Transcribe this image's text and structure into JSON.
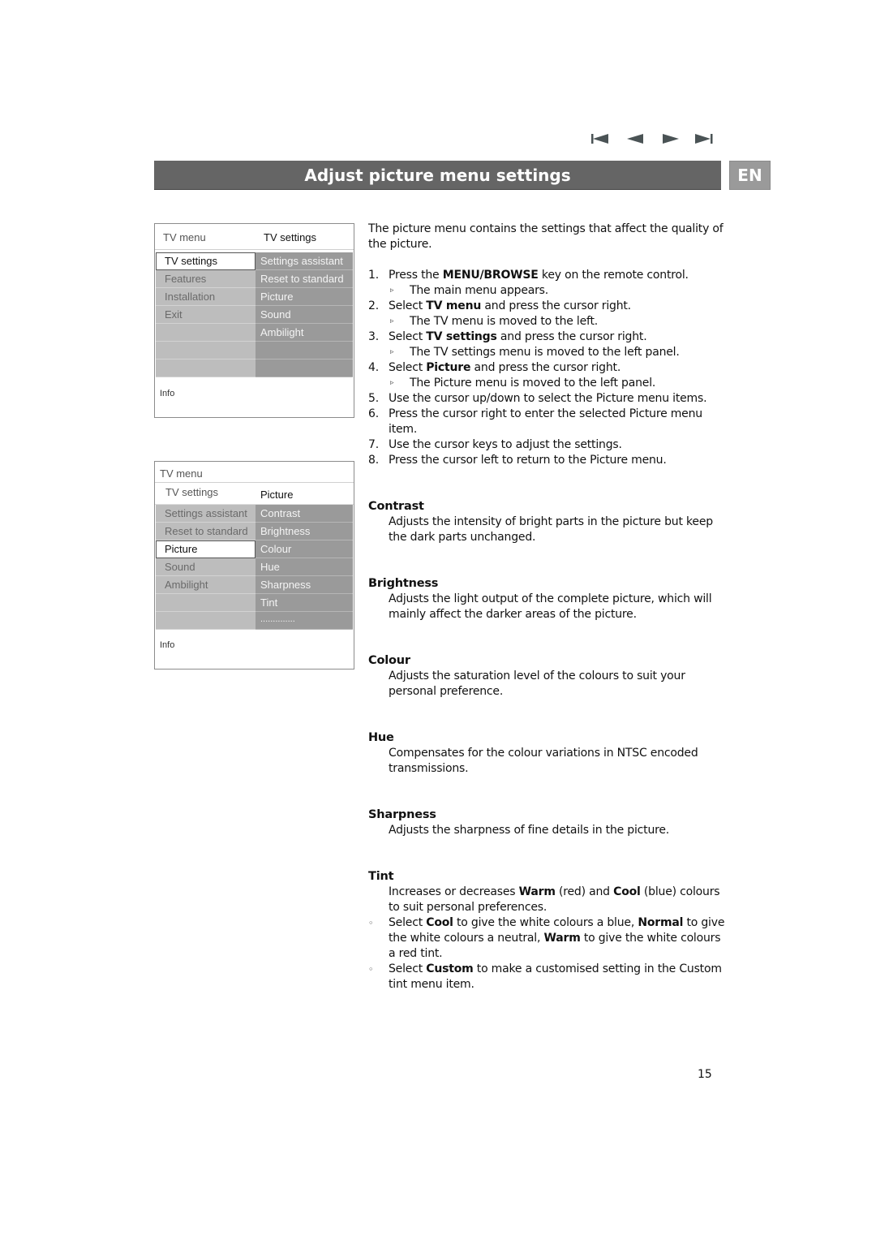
{
  "nav": {
    "icons": [
      "first-page-icon",
      "previous-page-icon",
      "next-page-icon",
      "last-page-icon"
    ]
  },
  "header": {
    "title": "Adjust picture menu settings",
    "lang_badge": "EN",
    "bar_color": "#656565",
    "badge_color": "#9a9a9a"
  },
  "menu1": {
    "head_left": "TV menu",
    "head_right": "TV settings",
    "rows": [
      {
        "left": "TV settings",
        "right": "Settings assistant",
        "selected": true
      },
      {
        "left": "Features",
        "right": "Reset to standard"
      },
      {
        "left": "Installation",
        "right": "Picture"
      },
      {
        "left": "Exit",
        "right": "Sound"
      },
      {
        "left": "",
        "right": "Ambilight"
      },
      {
        "left": "",
        "right": ""
      },
      {
        "left": "",
        "right": ""
      }
    ],
    "info": "Info"
  },
  "menu2": {
    "head_top": "TV menu",
    "head_left": "TV settings",
    "head_right": "Picture",
    "rows": [
      {
        "left": "Settings assistant",
        "right": "Contrast"
      },
      {
        "left": "Reset to standard",
        "right": "Brightness"
      },
      {
        "left": "Picture",
        "right": "Colour",
        "selected": true
      },
      {
        "left": "Sound",
        "right": "Hue"
      },
      {
        "left": "Ambilight",
        "right": "Sharpness"
      },
      {
        "left": "",
        "right": "Tint"
      },
      {
        "left": "",
        "right": ".............."
      }
    ],
    "info": "Info"
  },
  "content": {
    "intro": "The picture menu contains the settings that affect the quality of the picture.",
    "steps": [
      {
        "num": "1.",
        "pre": "Press the ",
        "bold": "MENU/BROWSE",
        "post": " key on the remote control.",
        "sub": "The main menu appears."
      },
      {
        "num": "2.",
        "pre": "Select ",
        "bold": "TV menu",
        "post": " and press the cursor right.",
        "sub": "The TV menu is moved to the left."
      },
      {
        "num": "3.",
        "pre": "Select ",
        "bold": "TV settings",
        "post": " and press the cursor right.",
        "sub": "The TV settings menu is moved to the left panel."
      },
      {
        "num": "4.",
        "pre": "Select ",
        "bold": "Picture",
        "post": " and press the cursor right.",
        "sub": "The Picture menu is moved to the left panel."
      },
      {
        "num": "5.",
        "pre": "Use the cursor up/down to select the Picture menu items.",
        "bold": "",
        "post": ""
      },
      {
        "num": "6.",
        "pre": "Press the cursor right to enter the selected Picture menu item.",
        "bold": "",
        "post": ""
      },
      {
        "num": "7.",
        "pre": "Use the cursor keys to adjust the settings.",
        "bold": "",
        "post": ""
      },
      {
        "num": "8.",
        "pre": "Press the cursor left to return to the Picture menu.",
        "bold": "",
        "post": ""
      }
    ],
    "sub_marker": "▹",
    "sections": {
      "contrast": {
        "title": "Contrast",
        "body": "Adjusts the intensity of bright parts in the picture but keep the dark parts unchanged."
      },
      "brightness": {
        "title": "Brightness",
        "body": "Adjusts the light output of the complete picture, which will mainly affect the darker areas of the picture."
      },
      "colour": {
        "title": "Colour",
        "body": "Adjusts the saturation level of the colours to suit your personal preference."
      },
      "hue": {
        "title": "Hue",
        "body": "Compensates for the colour variations in NTSC encoded transmissions."
      },
      "sharpness": {
        "title": "Sharpness",
        "body": "Adjusts the sharpness of fine details in the picture."
      },
      "tint": {
        "title": "Tint",
        "body_1": "Increases or decreases ",
        "body_warm": "Warm",
        "body_2": " (red) and ",
        "body_cool": "Cool",
        "body_3": " (blue) colours to suit personal preferences.",
        "bullet1_a": "Select ",
        "bullet1_cool": "Cool",
        "bullet1_b": " to give the white colours a blue, ",
        "bullet1_normal": "Normal",
        "bullet1_c": " to give the white colours a neutral, ",
        "bullet1_warm": "Warm",
        "bullet1_d": " to give the white colours a red tint.",
        "bullet2_a": "Select ",
        "bullet2_custom": "Custom",
        "bullet2_b": " to make a customised setting in the Custom tint menu item.",
        "bullet_marker": "◦"
      }
    }
  },
  "page_number": "15"
}
